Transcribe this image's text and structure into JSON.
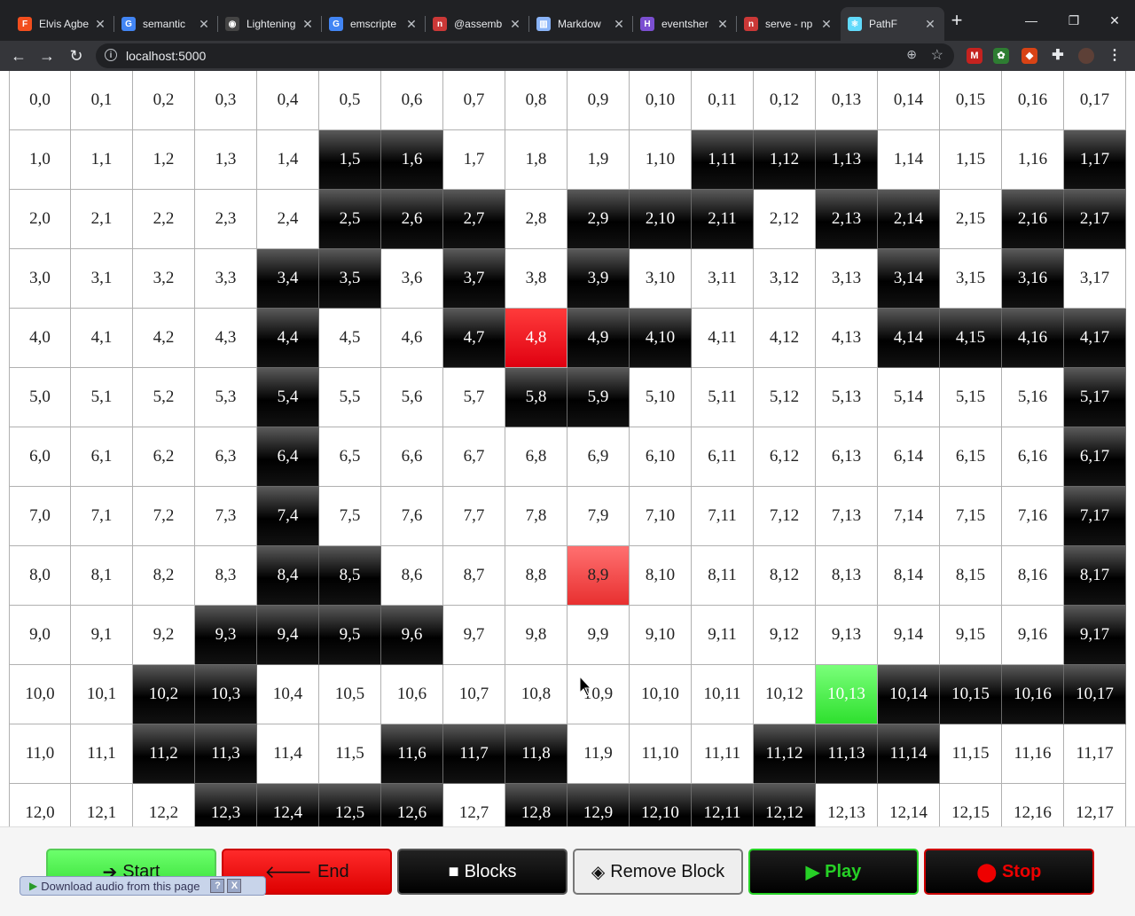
{
  "browser": {
    "tabs": [
      {
        "title": "Elvis Agbe",
        "icon": "figma-icon",
        "color": "#f24e1e",
        "glyph": "F"
      },
      {
        "title": "semantic",
        "icon": "google-icon",
        "color": "#4285f4",
        "glyph": "G"
      },
      {
        "title": "Lightening",
        "icon": "github-icon",
        "color": "#444444",
        "glyph": "◉"
      },
      {
        "title": "emscripte",
        "icon": "google-icon",
        "color": "#4285f4",
        "glyph": "G"
      },
      {
        "title": "@assemb",
        "icon": "npm-icon",
        "color": "#cb3837",
        "glyph": "n"
      },
      {
        "title": "Markdow",
        "icon": "document-icon",
        "color": "#8ab4f8",
        "glyph": "▥"
      },
      {
        "title": "eventsher",
        "icon": "app-icon",
        "color": "#7b4fd1",
        "glyph": "H"
      },
      {
        "title": "serve - np",
        "icon": "npm-icon",
        "color": "#cb3837",
        "glyph": "n"
      },
      {
        "title": "PathF",
        "icon": "react-icon",
        "color": "#61dafb",
        "glyph": "⚛"
      }
    ],
    "url": "localhost:5000"
  },
  "grid": {
    "rows": 13,
    "cols": 18,
    "blocks": [
      "1,5",
      "1,6",
      "1,11",
      "1,12",
      "1,13",
      "1,17",
      "2,5",
      "2,6",
      "2,7",
      "2,9",
      "2,10",
      "2,11",
      "2,13",
      "2,14",
      "2,16",
      "2,17",
      "3,4",
      "3,5",
      "3,7",
      "3,9",
      "3,14",
      "3,16",
      "4,4",
      "4,7",
      "4,9",
      "4,10",
      "4,14",
      "4,15",
      "4,16",
      "4,17",
      "5,4",
      "5,8",
      "5,9",
      "5,17",
      "6,4",
      "6,17",
      "7,4",
      "7,17",
      "8,4",
      "8,5",
      "8,17",
      "9,3",
      "9,4",
      "9,5",
      "9,6",
      "9,17",
      "10,2",
      "10,3",
      "10,14",
      "10,15",
      "10,16",
      "10,17",
      "11,2",
      "11,3",
      "11,6",
      "11,7",
      "11,8",
      "11,12",
      "11,13",
      "11,14",
      "12,3",
      "12,4",
      "12,5",
      "12,6",
      "12,8",
      "12,9",
      "12,10",
      "12,11",
      "12,12"
    ],
    "start": "10,13",
    "end": "4,8",
    "end_hover": "8,9"
  },
  "controls": {
    "start": "Start",
    "end": "End",
    "blocks": "Blocks",
    "remove_block": "Remove Block",
    "play": "Play",
    "stop": "Stop"
  },
  "audio_bar": {
    "label": "Download audio from this page",
    "help": "?",
    "close": "X"
  }
}
